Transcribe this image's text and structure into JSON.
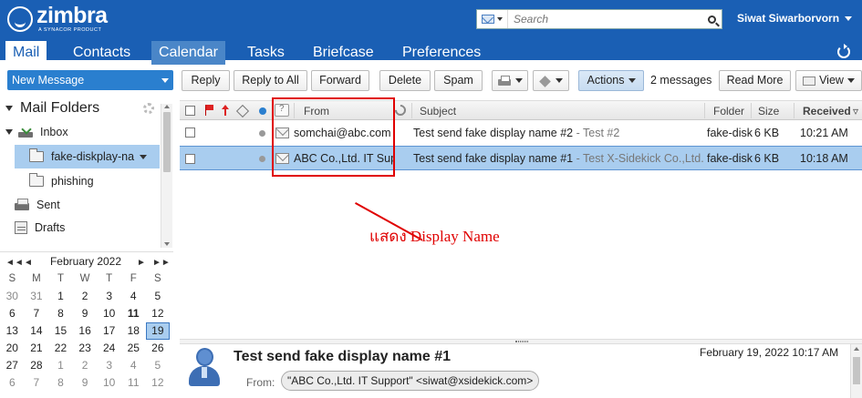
{
  "header": {
    "logo_text": "zimbra",
    "logo_tagline": "A SYNACOR PRODUCT",
    "search_placeholder": "Search",
    "user_name": "Siwat Siwarborvorn",
    "brand_color": "#1a5fb4"
  },
  "app_tabs": [
    {
      "label": "Mail",
      "state": "active"
    },
    {
      "label": "Contacts"
    },
    {
      "label": "Calendar",
      "state": "hover"
    },
    {
      "label": "Tasks"
    },
    {
      "label": "Briefcase"
    },
    {
      "label": "Preferences"
    }
  ],
  "toolbar": {
    "new_message": "New Message",
    "reply": "Reply",
    "reply_all": "Reply to All",
    "forward": "Forward",
    "delete": "Delete",
    "spam": "Spam",
    "actions": "Actions",
    "message_count": "2 messages",
    "read_more": "Read More",
    "view": "View"
  },
  "sidebar": {
    "title": "Mail Folders",
    "folders": [
      {
        "label": "Inbox",
        "icon": "inbox-icon"
      },
      {
        "label": "fake-diskplay-na",
        "icon": "folder-icon",
        "selected": true
      },
      {
        "label": "phishing",
        "icon": "folder-icon"
      },
      {
        "label": "Sent",
        "icon": "sent-icon"
      },
      {
        "label": "Drafts",
        "icon": "drafts-icon"
      }
    ]
  },
  "calendar": {
    "month": "February 2022",
    "nav_prev_year": "◄◄",
    "nav_prev": "◄",
    "nav_next": "►",
    "nav_next_year": "►►",
    "days_of_week": [
      "S",
      "M",
      "T",
      "W",
      "T",
      "F",
      "S"
    ],
    "weeks": [
      [
        "30",
        "31",
        "1",
        "2",
        "3",
        "4",
        "5"
      ],
      [
        "6",
        "7",
        "8",
        "9",
        "10",
        "11",
        "12"
      ],
      [
        "13",
        "14",
        "15",
        "16",
        "17",
        "18",
        "19"
      ],
      [
        "20",
        "21",
        "22",
        "23",
        "24",
        "25",
        "26"
      ],
      [
        "27",
        "28",
        "1",
        "2",
        "3",
        "4",
        "5"
      ],
      [
        "6",
        "7",
        "8",
        "9",
        "10",
        "11",
        "12"
      ]
    ],
    "today": "19",
    "bold_day": "11"
  },
  "list": {
    "columns": {
      "from": "From",
      "subject": "Subject",
      "folder": "Folder",
      "size": "Size",
      "received": "Received"
    },
    "messages": [
      {
        "from": "somchai@abc.com",
        "subject": "Test send fake display name #2",
        "fragment": " - Test #2",
        "folder": "fake-disk",
        "size": "6 KB",
        "received": "10:21 AM"
      },
      {
        "from": "ABC Co.,Ltd. IT Support",
        "subject": "Test send fake display name #1",
        "fragment": " - Test X-Sidekick Co.,Ltd. 1",
        "folder": "fake-disk",
        "size": "6 KB",
        "received": "10:18 AM",
        "selected": true
      }
    ]
  },
  "annotation": {
    "text": "แสดง Display Name",
    "color": "#e00000"
  },
  "reading_pane": {
    "subject": "Test send fake display name #1",
    "date": "February 19, 2022 10:17 AM",
    "from_label": "From:",
    "from_value": "\"ABC Co.,Ltd. IT Support\" <siwat@xsidekick.com>"
  }
}
